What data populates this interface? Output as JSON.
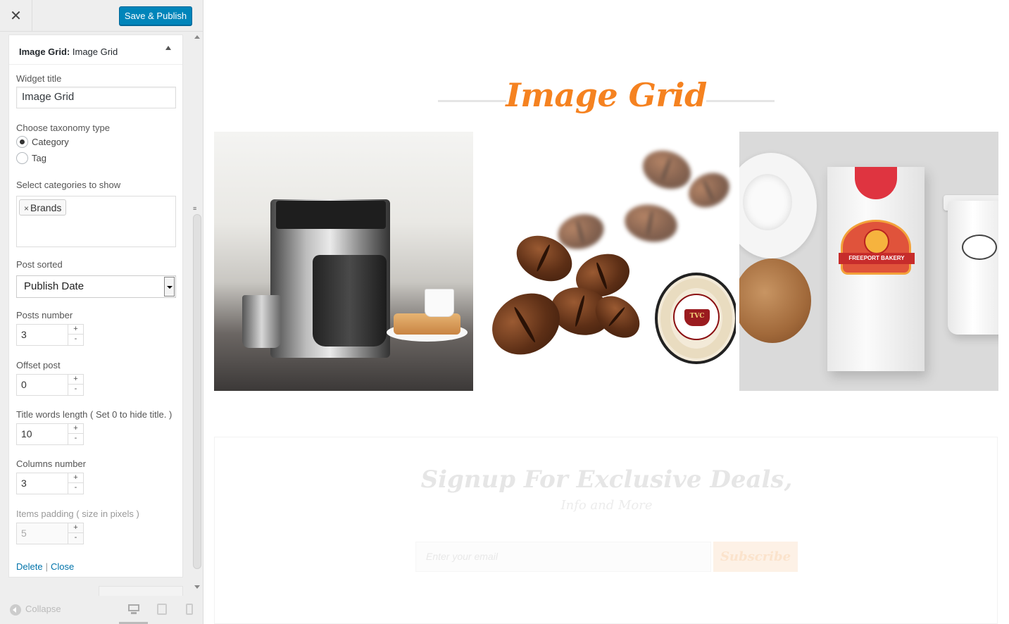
{
  "customizer": {
    "close_icon": "close-icon",
    "save_publish": "Save & Publish",
    "widget": {
      "header_bold": "Image Grid:",
      "header_title": "Image Grid",
      "fields": {
        "widget_title_label": "Widget title",
        "widget_title_value": "Image Grid",
        "taxonomy_label": "Choose taxonomy type",
        "taxonomy_options": [
          "Category",
          "Tag"
        ],
        "taxonomy_selected": "Category",
        "categories_label": "Select categories to show",
        "selected_categories": [
          "Brands"
        ],
        "chip_remove": "×",
        "post_sorted_label": "Post sorted",
        "post_sorted_value": "Publish Date",
        "posts_number_label": "Posts number",
        "posts_number_value": "3",
        "offset_label": "Offset post",
        "offset_value": "0",
        "title_words_label": "Title words length ( Set 0 to hide title. )",
        "title_words_value": "10",
        "columns_label": "Columns number",
        "columns_value": "3",
        "padding_label": "Items padding ( size in pixels )",
        "padding_value": "5",
        "spin_up": "+",
        "spin_down": "-"
      },
      "actions": {
        "delete": "Delete",
        "separator": "|",
        "close": "Close"
      }
    },
    "footer": {
      "collapse": "Collapse",
      "devices": [
        "desktop",
        "tablet",
        "mobile"
      ],
      "active_device": "desktop"
    }
  },
  "preview": {
    "grid_title": "Image Grid",
    "accent_color": "#f58220",
    "images": [
      {
        "name": "coffee-maker-image"
      },
      {
        "name": "coffee-beans-image",
        "seal_text": "TVC"
      },
      {
        "name": "bakery-mockup-image",
        "badge_text": "FREEPORT BAKERY"
      }
    ],
    "signup": {
      "title": "Signup For Exclusive Deals,",
      "subtitle": "Info and More",
      "email_placeholder": "Enter your email",
      "button": "Subscribe"
    }
  },
  "colors": {
    "primary_button": "#0085ba",
    "link": "#0073aa",
    "sidebar_bg": "#eeeeee"
  }
}
